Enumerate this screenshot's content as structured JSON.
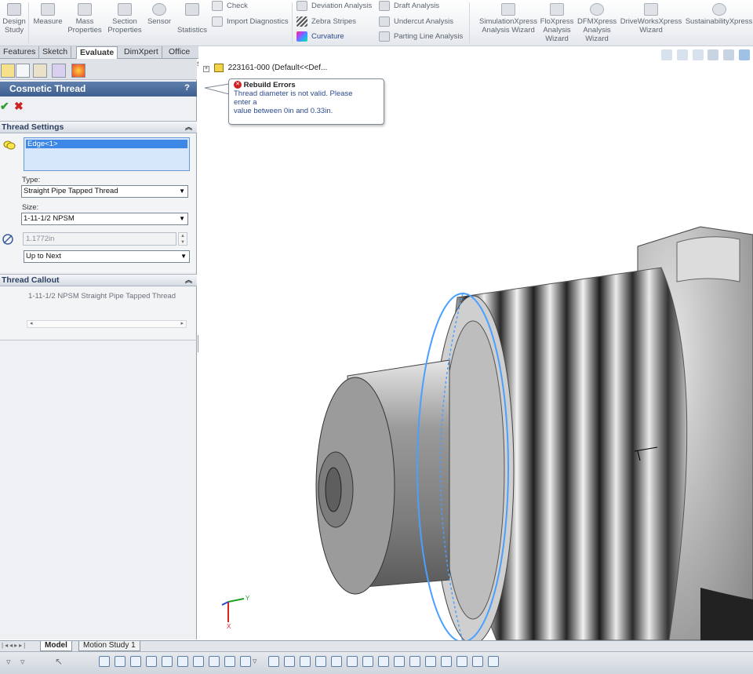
{
  "ribbon": {
    "design_study": [
      "Design",
      "Study"
    ],
    "measure": "Measure",
    "mass_properties": [
      "Mass",
      "Properties"
    ],
    "section_properties": [
      "Section",
      "Properties"
    ],
    "sensor": "Sensor",
    "statistics": "Statistics",
    "check": "Check",
    "import_diagnostics": "Import Diagnostics",
    "deviation_analysis": "Deviation Analysis",
    "zebra_stripes": "Zebra Stripes",
    "curvature": "Curvature",
    "draft_analysis": "Draft Analysis",
    "undercut_analysis": "Undercut Analysis",
    "parting_line_analysis": "Parting Line Analysis",
    "simulationxpress": [
      "SimulationXpress",
      "Analysis Wizard"
    ],
    "floxpress": [
      "FloXpress",
      "Analysis",
      "Wizard"
    ],
    "dfmxpress": [
      "DFMXpress",
      "Analysis",
      "Wizard"
    ],
    "driveworksxpress": [
      "DriveWorksXpress",
      "Wizard"
    ],
    "sustainabilityxpress": "SustainabilityXpress"
  },
  "tabs": [
    "Features",
    "Sketch",
    "Evaluate",
    "DimXpert",
    "Office Products"
  ],
  "active_tab": "Evaluate",
  "property_manager": {
    "title": "Cosmetic Thread",
    "help": "?",
    "ok_glyph": "✔",
    "cancel_glyph": "✖",
    "thread_settings": {
      "header": "Thread Settings",
      "edge": "Edge<1>",
      "type_label": "Type:",
      "type_value": "Straight Pipe Tapped Thread",
      "size_label": "Size:",
      "size_value": "1-11-1/2 NPSM",
      "diameter": "1.1772in",
      "end_condition": "Up to Next"
    },
    "thread_callout": {
      "header": "Thread Callout",
      "text": "1-11-1/2 NPSM Straight Pipe Tapped Thread"
    }
  },
  "viewport": {
    "tree_root": "223161-000  (Default<<Def...",
    "tooltip": {
      "title": "Rebuild Errors",
      "line1": "Thread diameter is not valid. Please",
      "line2": "enter a",
      "line3": "value between 0in and 0.33in."
    }
  },
  "bottom_tabs": [
    "Model",
    "Motion Study 1"
  ],
  "colors": {
    "accent": "#3d87e6",
    "title_bar": "#4f6f9f",
    "selection_edge": "#4aa0ff",
    "error": "#cc2222"
  }
}
